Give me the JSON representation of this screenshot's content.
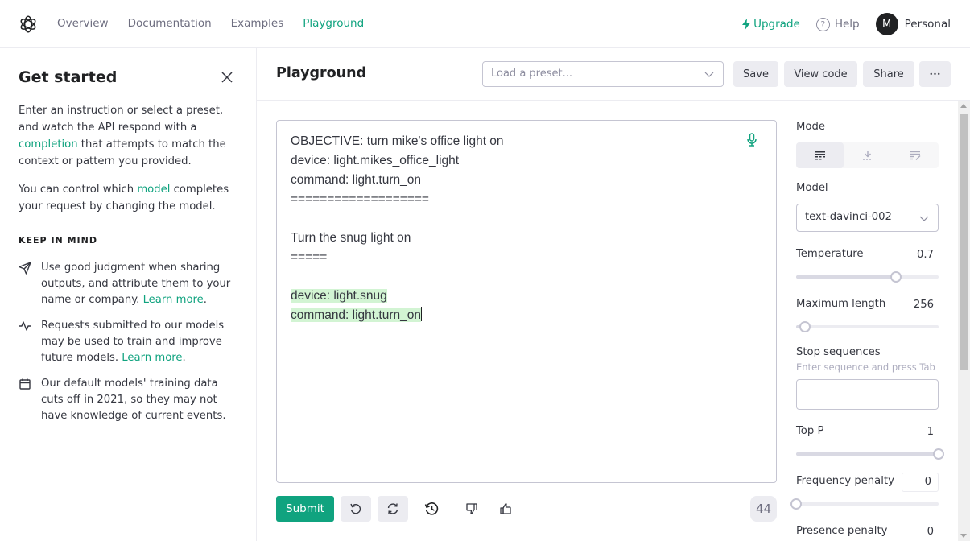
{
  "nav": {
    "links": [
      {
        "label": "Overview",
        "active": false
      },
      {
        "label": "Documentation",
        "active": false
      },
      {
        "label": "Examples",
        "active": false
      },
      {
        "label": "Playground",
        "active": true
      }
    ],
    "upgrade": "Upgrade",
    "help": "Help",
    "help_glyph": "?",
    "avatar_initial": "M",
    "account": "Personal"
  },
  "sidebar": {
    "title": "Get started",
    "para1": {
      "before": "Enter an instruction or select a preset, and watch the API respond with a ",
      "link": "completion",
      "after": " that attempts to match the context or pattern you provided."
    },
    "para2": {
      "before": "You can control which ",
      "link": "model",
      "after": " completes your request by changing the model."
    },
    "keep_in_mind": "KEEP IN MIND",
    "tips": [
      {
        "icon": "send-icon",
        "text": "Use good judgment when sharing outputs, and attribute them to your name or company. ",
        "link": "Learn more",
        "after": "."
      },
      {
        "icon": "activity-icon",
        "text": "Requests submitted to our models may be used to train and improve future models. ",
        "link": "Learn more",
        "after": "."
      },
      {
        "icon": "calendar-icon",
        "text": "Our default models' training data cuts off in 2021, so they may not have knowledge of current events.",
        "link": "",
        "after": ""
      }
    ]
  },
  "header": {
    "title": "Playground",
    "preset_placeholder": "Load a preset...",
    "save": "Save",
    "view_code": "View code",
    "share": "Share",
    "more": "•••"
  },
  "editor": {
    "prompt_lines": [
      "OBJECTIVE: turn mike's office light on",
      "device: light.mikes_office_light",
      "command: light.turn_on",
      "===================",
      "",
      "Turn the snug light on",
      "=====",
      ""
    ],
    "completion_lines": [
      "device: light.snug",
      "command: light.turn_on"
    ]
  },
  "toolbar": {
    "submit": "Submit",
    "token_count": "44"
  },
  "settings": {
    "mode_label": "Mode",
    "modes": [
      {
        "name": "complete",
        "active": true
      },
      {
        "name": "insert",
        "active": false
      },
      {
        "name": "edit",
        "active": false
      }
    ],
    "model_label": "Model",
    "model_value": "text-davinci-002",
    "temperature": {
      "label": "Temperature",
      "value": "0.7",
      "fraction": 0.7
    },
    "max_length": {
      "label": "Maximum length",
      "value": "256",
      "fraction": 0.06
    },
    "stop_sequences": {
      "label": "Stop sequences",
      "hint": "Enter sequence and press Tab",
      "value": ""
    },
    "top_p": {
      "label": "Top P",
      "value": "1",
      "fraction": 1.0
    },
    "frequency_penalty": {
      "label": "Frequency penalty",
      "value": "0",
      "fraction": 0.0
    },
    "presence_penalty": {
      "label": "Presence penalty",
      "value": "0"
    }
  },
  "colors": {
    "accent": "#10a37f",
    "completion_highlight": "#d2f4d3",
    "text": "#353740",
    "muted": "#6e6e80"
  }
}
